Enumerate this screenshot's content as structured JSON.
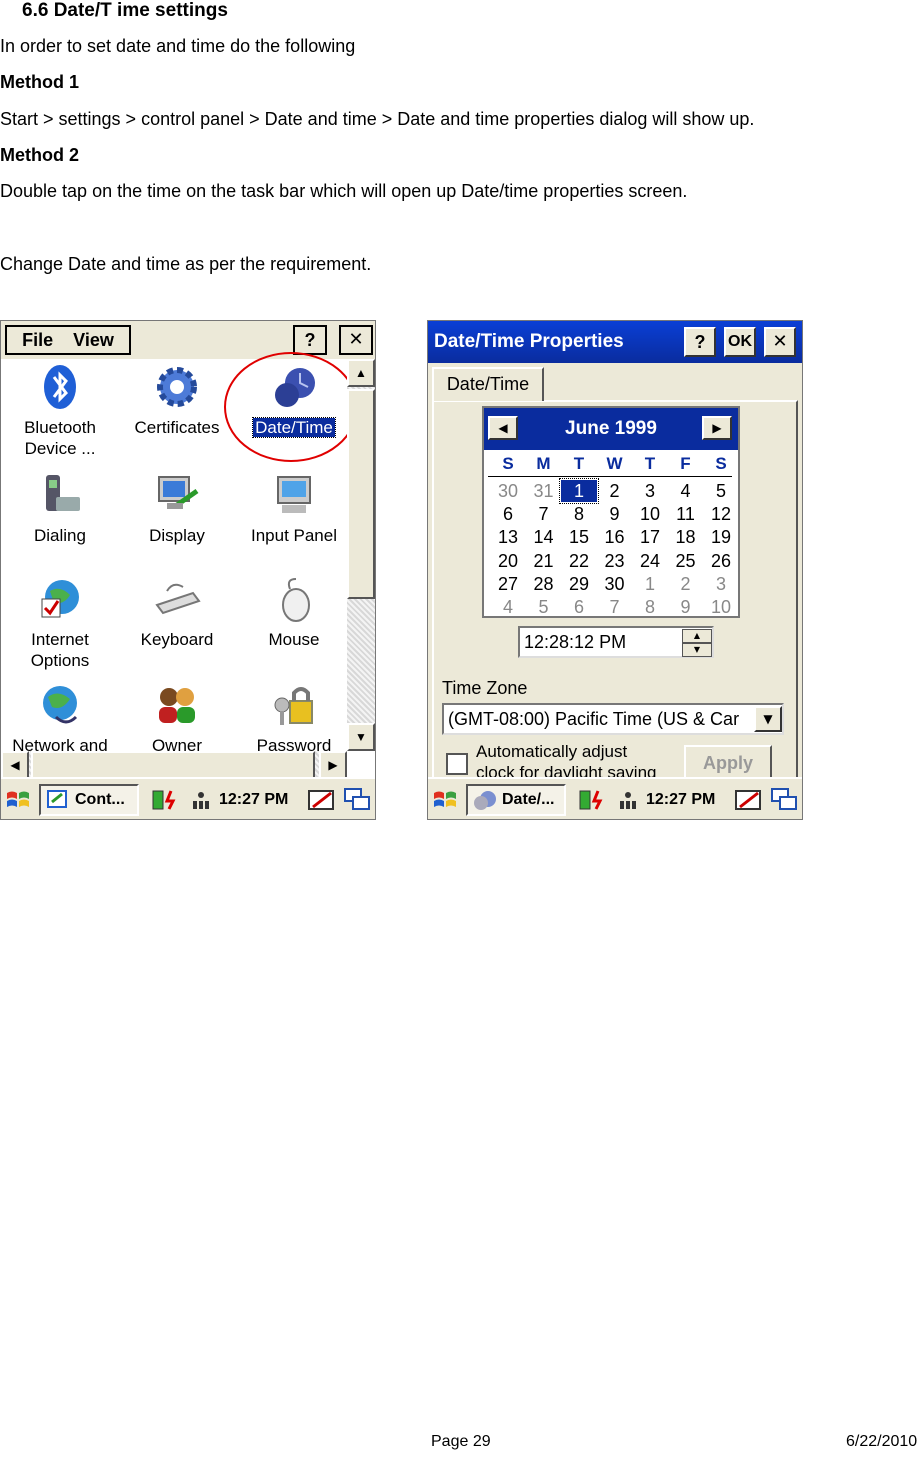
{
  "doc": {
    "section_title": "6.6 Date/T    ime settings",
    "intro": "In order to set date and time do the following",
    "method1_heading": "Method 1",
    "method1_text": "Start > settings > control panel > Date and time > Date and time properties dialog will show up.",
    "method2_heading": "Method 2",
    "method2_text": "Double tap on the time on the task bar which will open up Date/time properties screen.",
    "change_text": "Change Date and time as per the requirement.",
    "footer_page": "Page 29",
    "footer_date": "6/22/2010"
  },
  "control_panel": {
    "menu": [
      "File",
      "View"
    ],
    "help_label": "?",
    "close_label": "✕",
    "icons": [
      {
        "label": "Bluetooth\nDevice ...",
        "icon": "bluetooth-icon"
      },
      {
        "label": "Certificates",
        "icon": "certificate-gear-icon"
      },
      {
        "label": "Date/Time",
        "icon": "globe-clock-icon",
        "selected": true
      },
      {
        "label": "Dialing",
        "icon": "phone-icon"
      },
      {
        "label": "Display",
        "icon": "monitor-icon"
      },
      {
        "label": "Input Panel",
        "icon": "keyboard-monitor-icon"
      },
      {
        "label": "Internet\nOptions",
        "icon": "internet-globe-icon"
      },
      {
        "label": "Keyboard",
        "icon": "keyboard-icon"
      },
      {
        "label": "Mouse",
        "icon": "mouse-icon"
      },
      {
        "label": "Network and",
        "icon": "network-globe-icon"
      },
      {
        "label": "Owner",
        "icon": "owner-users-icon"
      },
      {
        "label": "Password",
        "icon": "password-lock-icon"
      }
    ],
    "highlight_color": "#e00000",
    "taskbar": {
      "task": "Cont...",
      "clock": "12:27 PM"
    }
  },
  "datetime": {
    "title": "Date/Time Properties",
    "help_label": "?",
    "ok_label": "OK",
    "close_label": "✕",
    "tab": "Date/Time",
    "month_year": "June 1999",
    "prev_label": "◀",
    "next_label": "▶",
    "weekdays": [
      "S",
      "M",
      "T",
      "W",
      "T",
      "F",
      "S"
    ],
    "weeks": [
      [
        "30",
        "31",
        "1",
        "2",
        "3",
        "4",
        "5"
      ],
      [
        "6",
        "7",
        "8",
        "9",
        "10",
        "11",
        "12"
      ],
      [
        "13",
        "14",
        "15",
        "16",
        "17",
        "18",
        "19"
      ],
      [
        "20",
        "21",
        "22",
        "23",
        "24",
        "25",
        "26"
      ],
      [
        "27",
        "28",
        "29",
        "30",
        "1",
        "2",
        "3"
      ],
      [
        "4",
        "5",
        "6",
        "7",
        "8",
        "9",
        "10"
      ]
    ],
    "selected_day": "1",
    "time_value": "12:28:12 PM",
    "timezone_label": "Time Zone",
    "timezone_value": "(GMT-08:00) Pacific Time (US & Car",
    "dst_line1": "Automatically adjust",
    "dst_line2": "clock for daylight saving",
    "apply_label": "Apply",
    "taskbar": {
      "task": "Date/...",
      "clock": "12:27 PM"
    },
    "accent": "#0a2c9e"
  }
}
